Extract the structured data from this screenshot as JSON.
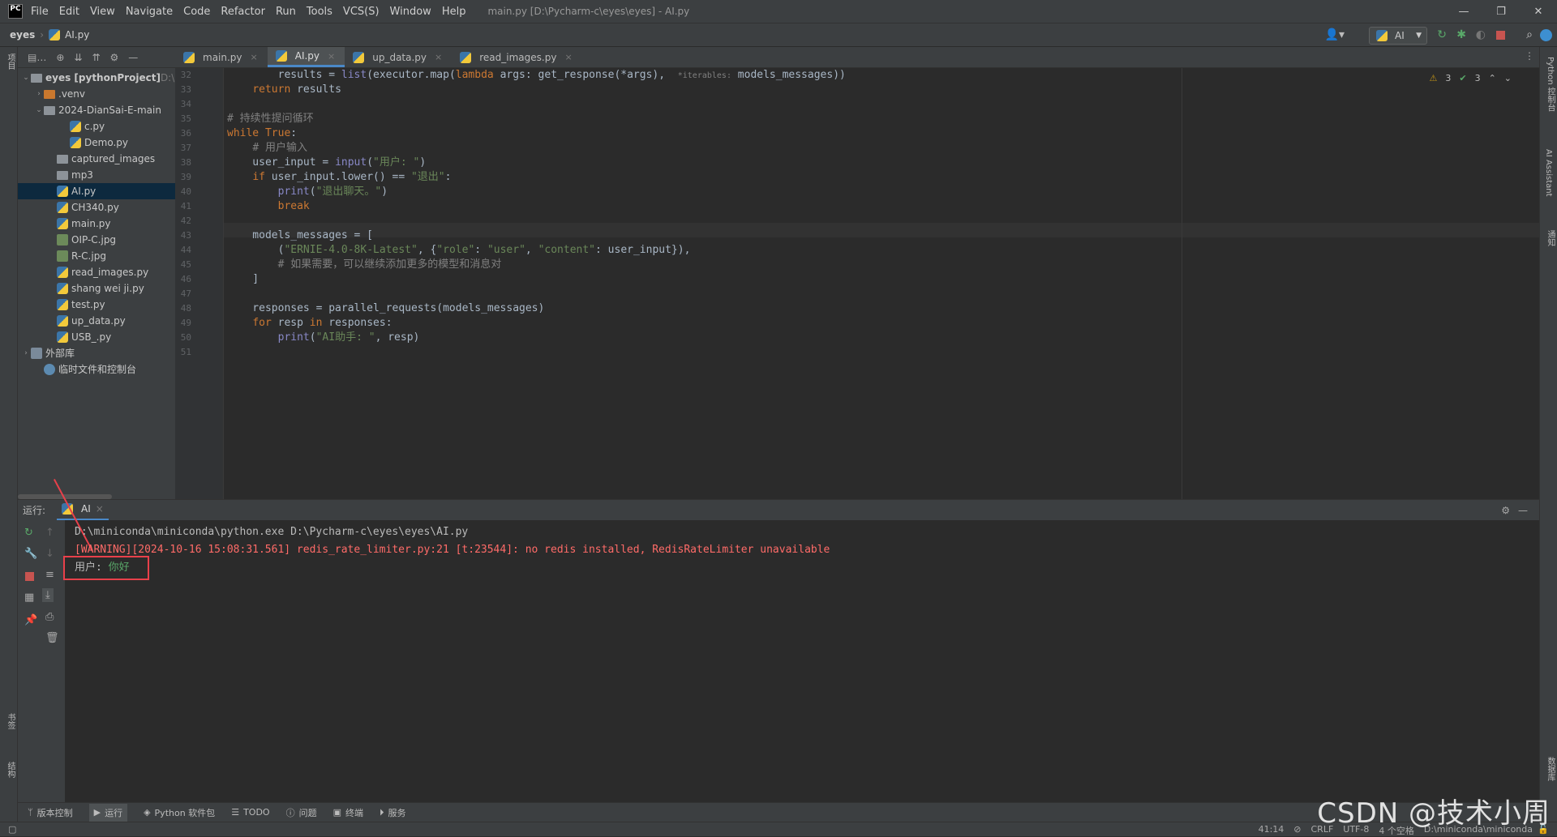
{
  "window": {
    "title": "main.py [D:\\Pycharm-c\\eyes\\eyes] - AI.py",
    "logo": "PC",
    "controls": [
      "—",
      "❐",
      "✕"
    ]
  },
  "menu": [
    "File",
    "Edit",
    "View",
    "Navigate",
    "Code",
    "Refactor",
    "Run",
    "Tools",
    "VCS(S)",
    "Window",
    "Help"
  ],
  "breadcrumb": {
    "project": "eyes",
    "file": "AI.py"
  },
  "run_config": {
    "label": "AI"
  },
  "left_strip": {
    "top_label": "项目",
    "bottom_label1": "书签",
    "bottom_label2": "结构"
  },
  "right_strip": {
    "label1": "Python 控制台",
    "label2": "AI Assistant",
    "label3": "通知",
    "label4": "数据库"
  },
  "project_tree": [
    {
      "label": "eyes [pythonProject]",
      "suffix": "D:\\",
      "indent": 0,
      "twisty": "⌄",
      "icon": "folder",
      "bold": true
    },
    {
      "label": ".venv",
      "indent": 1,
      "twisty": "›",
      "icon": "venv"
    },
    {
      "label": "2024-DianSai-E-main",
      "indent": 1,
      "twisty": "⌄",
      "icon": "folder"
    },
    {
      "label": "c.py",
      "indent": 3,
      "twisty": "",
      "icon": "py"
    },
    {
      "label": "Demo.py",
      "indent": 3,
      "twisty": "",
      "icon": "py"
    },
    {
      "label": "captured_images",
      "indent": 2,
      "twisty": "",
      "icon": "folder"
    },
    {
      "label": "mp3",
      "indent": 2,
      "twisty": "",
      "icon": "folder"
    },
    {
      "label": "AI.py",
      "indent": 2,
      "twisty": "",
      "icon": "py",
      "selected": true
    },
    {
      "label": "CH340.py",
      "indent": 2,
      "twisty": "",
      "icon": "py"
    },
    {
      "label": "main.py",
      "indent": 2,
      "twisty": "",
      "icon": "py"
    },
    {
      "label": "OIP-C.jpg",
      "indent": 2,
      "twisty": "",
      "icon": "img"
    },
    {
      "label": "R-C.jpg",
      "indent": 2,
      "twisty": "",
      "icon": "img"
    },
    {
      "label": "read_images.py",
      "indent": 2,
      "twisty": "",
      "icon": "py"
    },
    {
      "label": "shang wei ji.py",
      "indent": 2,
      "twisty": "",
      "icon": "py"
    },
    {
      "label": "test.py",
      "indent": 2,
      "twisty": "",
      "icon": "py"
    },
    {
      "label": "up_data.py",
      "indent": 2,
      "twisty": "",
      "icon": "py"
    },
    {
      "label": "USB_.py",
      "indent": 2,
      "twisty": "",
      "icon": "py"
    },
    {
      "label": "外部库",
      "indent": 0,
      "twisty": "›",
      "icon": "lib"
    },
    {
      "label": "临时文件和控制台",
      "indent": 1,
      "twisty": "",
      "icon": "tmp"
    }
  ],
  "tabs": [
    {
      "label": "main.py",
      "active": false
    },
    {
      "label": "AI.py",
      "active": true
    },
    {
      "label": "up_data.py",
      "active": false
    },
    {
      "label": "read_images.py",
      "active": false
    }
  ],
  "inspections": {
    "warnings": "3",
    "ok": "3"
  },
  "code_lines": [
    {
      "n": "32",
      "html": "        results = <span class=\"fn\">list</span>(executor.map(<span class=\"kw\">lambda</span> args: get_response(*args),  <span class=\"cm\" style=\"font-size:10px\">*iterables:</span> models_messages))"
    },
    {
      "n": "33",
      "html": "    <span class=\"kw\">return</span> results"
    },
    {
      "n": "34",
      "html": ""
    },
    {
      "n": "35",
      "html": "<span class=\"cm\"># 持续性提问循环</span>"
    },
    {
      "n": "36",
      "html": "<span class=\"kw\">while True</span>:"
    },
    {
      "n": "37",
      "html": "    <span class=\"cm\"># 用户输入</span>"
    },
    {
      "n": "38",
      "html": "    user_input = <span class=\"fn\">input</span>(<span class=\"str\">\"用户: \"</span>)"
    },
    {
      "n": "39",
      "html": "    <span class=\"kw\">if</span> user_input.lower() == <span class=\"str\">\"退出\"</span>:"
    },
    {
      "n": "40",
      "html": "        <span class=\"fn\">print</span>(<span class=\"str\">\"退出聊天。\"</span>)"
    },
    {
      "n": "41",
      "html": "        <span class=\"kw\">break</span>"
    },
    {
      "n": "42",
      "html": ""
    },
    {
      "n": "43",
      "html": "    models_messages = ["
    },
    {
      "n": "44",
      "html": "        (<span class=\"str\">\"ERNIE-4.0-8K-Latest\"</span>, {<span class=\"str\">\"role\"</span>: <span class=\"str\">\"user\"</span>, <span class=\"str\">\"content\"</span>: user_input}),"
    },
    {
      "n": "45",
      "html": "        <span class=\"cm\"># 如果需要，可以继续添加更多的模型和消息对</span>"
    },
    {
      "n": "46",
      "html": "    ]"
    },
    {
      "n": "47",
      "html": ""
    },
    {
      "n": "48",
      "html": "    responses = parallel_requests(models_messages)"
    },
    {
      "n": "49",
      "html": "    <span class=\"kw\">for</span> resp <span class=\"kw\">in</span> responses:"
    },
    {
      "n": "50",
      "html": "        <span class=\"fn\">print</span>(<span class=\"str\">\"AI助手: \"</span>, resp)"
    },
    {
      "n": "51",
      "html": ""
    }
  ],
  "run_panel": {
    "label": "运行:",
    "tab": "AI",
    "console": {
      "cmd": "D:\\miniconda\\miniconda\\python.exe D:\\Pycharm-c\\eyes\\eyes\\AI.py",
      "warning": "[WARNING][2024-10-16 15:08:31.561] redis_rate_limiter.py:21 [t:23544]: no redis installed, RedisRateLimiter unavailable",
      "prompt": "用户: ",
      "input": "你好"
    }
  },
  "bottom_tools": [
    {
      "icon": "ᛘ",
      "label": "版本控制"
    },
    {
      "icon": "▶",
      "label": "运行",
      "active": true
    },
    {
      "icon": "◈",
      "label": "Python 软件包"
    },
    {
      "icon": "☰",
      "label": "TODO"
    },
    {
      "icon": "ⓘ",
      "label": "问题"
    },
    {
      "icon": "▣",
      "label": "终端"
    },
    {
      "icon": "⏵",
      "label": "服务"
    }
  ],
  "status": {
    "position": "41:14",
    "line_sep": "CRLF",
    "encoding": "UTF-8",
    "indent": "4 个空格",
    "interpreter": "D:\\miniconda\\miniconda"
  },
  "watermark": "CSDN @技术小周",
  "colors": {
    "accent": "#4a88c7",
    "highlight_box": "#e8404a",
    "warning_text": "#ff6b68"
  }
}
